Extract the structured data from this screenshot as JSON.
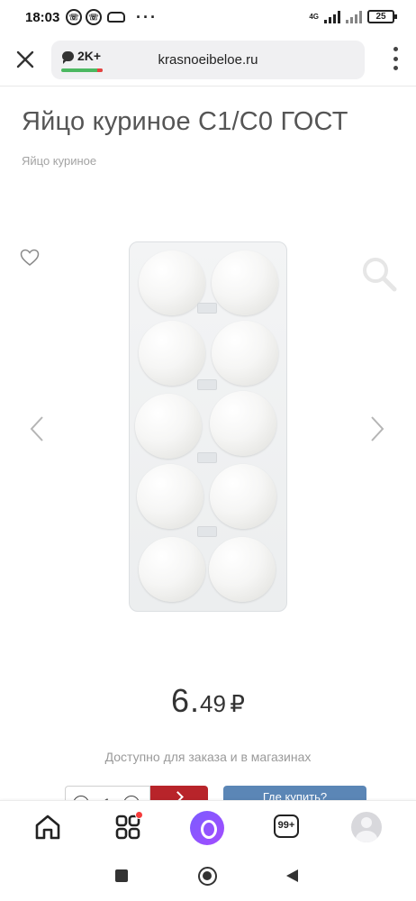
{
  "status_bar": {
    "time": "18:03",
    "network": "4G",
    "battery": "25"
  },
  "browser": {
    "comments_count": "2K+",
    "url": "krasnoeibeloe.ru"
  },
  "product": {
    "title": "Яйцо куриное С1/С0 ГОСТ",
    "category": "Яйцо куриное",
    "price_int": "6.",
    "price_frac": "49",
    "currency": "₽",
    "availability": "Доступно для заказа и в магазинах",
    "quantity": "1",
    "where_to_buy": "Где купить?",
    "accent_color": "#b8242a",
    "secondary_button_color": "#5b86b6"
  },
  "bottom_nav": {
    "tabs_count": "99+"
  }
}
